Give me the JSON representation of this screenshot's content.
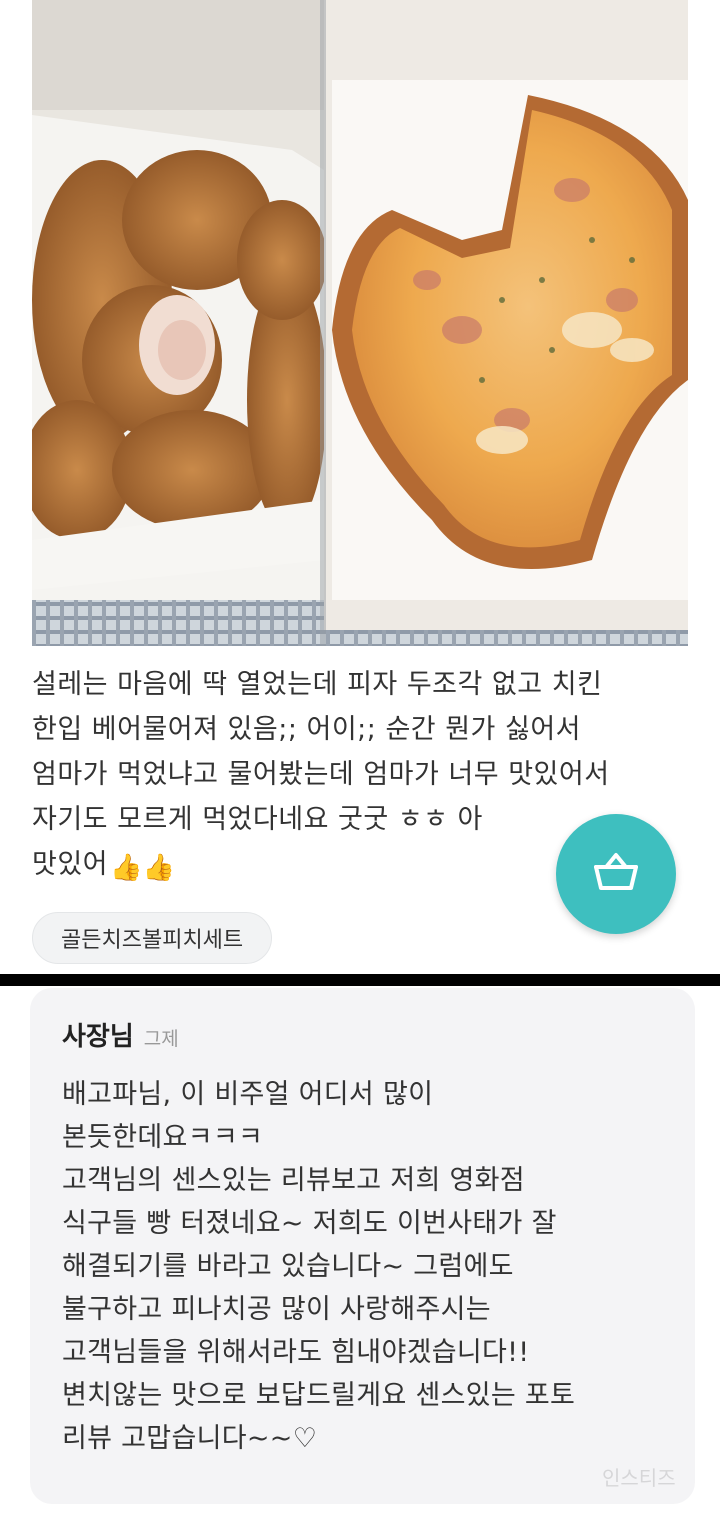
{
  "review": {
    "text_lines": [
      "설레는 마음에 딱 열었는데 피자 두조각 없고 치킨",
      "한입 베어물어져 있음;; 어이;; 순간 뭔가 싫어서",
      "엄마가 먹었냐고 물어봤는데 엄마가 너무 맛있어서",
      "자기도 모르게 먹었다네요 굿굿 ㅎㅎ 아",
      "맛있어"
    ],
    "emoji": "👍👍",
    "menu_tag": "골든치즈볼피치세트"
  },
  "owner_reply": {
    "author": "사장님",
    "time": "그제",
    "lines": [
      "배고파님, 이 비주얼 어디서 많이",
      "본듯한데요ㅋㅋㅋ",
      "고객님의 센스있는 리뷰보고 저희 영화점",
      "식구들  빵 터졌네요~ 저희도 이번사태가 잘",
      "해결되기를 바라고 있습니다~ 그럼에도",
      "불구하고 피나치공 많이 사랑해주시는",
      "고객님들을 위해서라도 힘내야겠습니다!!",
      "변치않는 맛으로 보답드릴게요 센스있는 포토",
      "리뷰 고맙습니다~~♡"
    ]
  },
  "icons": {
    "cart": "shopping-basket-icon"
  },
  "colors": {
    "fab": "#3ebfbf",
    "card_bg": "#f4f4f6",
    "tag_bg": "#f2f3f4"
  },
  "watermark": "인스티즈"
}
